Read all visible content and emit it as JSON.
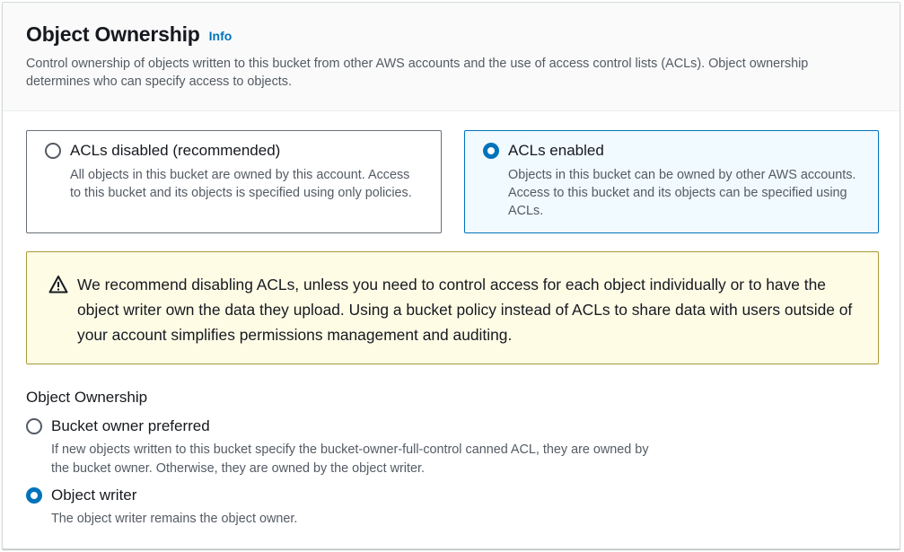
{
  "header": {
    "title": "Object Ownership",
    "info_label": "Info",
    "description": "Control ownership of objects written to this bucket from other AWS accounts and the use of access control lists (ACLs). Object ownership determines who can specify access to objects."
  },
  "acl_tiles": [
    {
      "label": "ACLs disabled (recommended)",
      "description": "All objects in this bucket are owned by this account. Access to this bucket and its objects is specified using only policies.",
      "selected": false
    },
    {
      "label": "ACLs enabled",
      "description": "Objects in this bucket can be owned by other AWS accounts. Access to this bucket and its objects can be specified using ACLs.",
      "selected": true
    }
  ],
  "alert": {
    "icon": "warning-icon",
    "text": "We recommend disabling ACLs, unless you need to control access for each object individually or to have the object writer own the data they upload. Using a bucket policy instead of ACLs to share data with users outside of your account simplifies permissions management and auditing."
  },
  "ownership": {
    "label": "Object Ownership",
    "options": [
      {
        "label": "Bucket owner preferred",
        "description": "If new objects written to this bucket specify the bucket-owner-full-control canned ACL, they are owned by the bucket owner. Otherwise, they are owned by the object writer.",
        "selected": false
      },
      {
        "label": "Object writer",
        "description": "The object writer remains the object owner.",
        "selected": true
      }
    ]
  },
  "colors": {
    "accent": "#0073bb",
    "selected_tile_bg": "#f1faff",
    "warning_bg": "#fffce6",
    "warning_border": "#a89a3a"
  }
}
